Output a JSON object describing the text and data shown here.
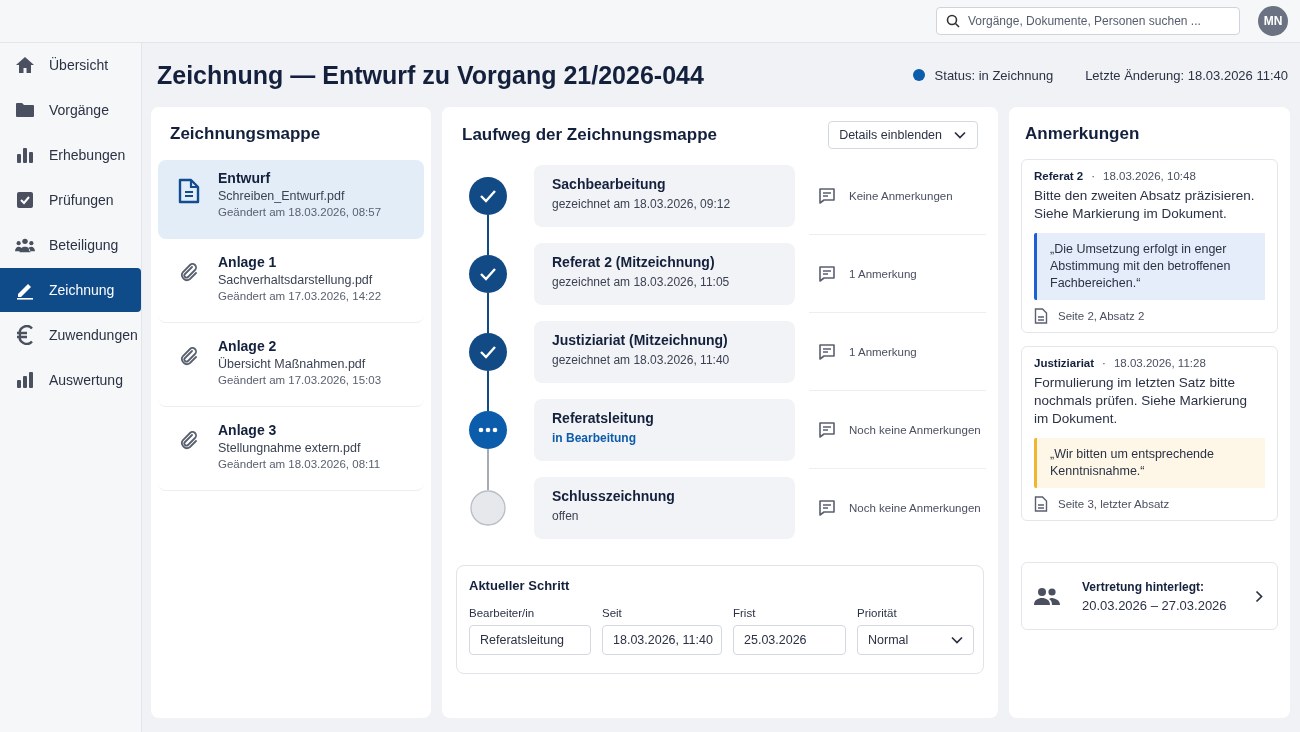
{
  "search": {
    "placeholder": "Vorgänge, Dokumente, Personen suchen ..."
  },
  "user": {
    "initials": "MN"
  },
  "sidebar": {
    "items": [
      {
        "label": "Übersicht",
        "selected": false
      },
      {
        "label": "Vorgänge",
        "selected": false
      },
      {
        "label": "Erhebungen",
        "selected": false
      },
      {
        "label": "Prüfungen",
        "selected": false
      },
      {
        "label": "Beteiligung",
        "selected": false
      },
      {
        "label": "Zeichnung",
        "selected": true
      },
      {
        "label": "Zuwendungen",
        "selected": false
      },
      {
        "label": "Auswertung",
        "selected": false
      }
    ]
  },
  "page": {
    "title": "Zeichnung — Entwurf zu Vorgang 21/2026-044",
    "status": "Status: in Zeichnung",
    "last_change": "Letzte Änderung: 18.03.2026 11:40"
  },
  "documents": {
    "title": "Zeichnungsmappe",
    "items": [
      {
        "kind": "document",
        "name": "Entwurf",
        "file": "Schreiben_Entwurf.pdf",
        "modified": "Geändert am 18.03.2026, 08:57",
        "selected": true
      },
      {
        "kind": "attachment",
        "name": "Anlage 1",
        "file": "Sachverhaltsdarstellung.pdf",
        "modified": "Geändert am 17.03.2026, 14:22",
        "selected": false
      },
      {
        "kind": "attachment",
        "name": "Anlage 2",
        "file": "Übersicht Maßnahmen.pdf",
        "modified": "Geändert am 17.03.2026, 15:03",
        "selected": false
      },
      {
        "kind": "attachment",
        "name": "Anlage 3",
        "file": "Stellungnahme extern.pdf",
        "modified": "Geändert am 18.03.2026, 08:11",
        "selected": false
      }
    ]
  },
  "route": {
    "title": "Laufweg der Zeichnungsmappe",
    "details_button": "Details einblenden",
    "steps": [
      {
        "name": "Sachbearbeitung",
        "detail": "gezeichnet am 18.03.2026, 09:12",
        "signed": true,
        "in_progress": false,
        "notes": "Keine Anmerkungen"
      },
      {
        "name": "Referat 2 (Mitzeichnung)",
        "detail": "gezeichnet am 18.03.2026, 11:05",
        "signed": true,
        "in_progress": false,
        "notes": "1 Anmerkung"
      },
      {
        "name": "Justiziariat (Mitzeichnung)",
        "detail": "gezeichnet am 18.03.2026, 11:40",
        "signed": true,
        "in_progress": false,
        "notes": "1 Anmerkung"
      },
      {
        "name": "Referatsleitung",
        "detail": "in Bearbeitung",
        "signed": false,
        "in_progress": true,
        "notes": "Noch keine Anmerkungen"
      },
      {
        "name": "Schlusszeichnung",
        "detail": "offen",
        "signed": false,
        "in_progress": false,
        "notes": "Noch keine Anmerkungen"
      }
    ],
    "current": {
      "title": "Aktueller Schritt",
      "fields": [
        {
          "kind": "text",
          "label": "Bearbeiter/in",
          "value": "Referatsleitung"
        },
        {
          "kind": "text",
          "label": "Seit",
          "value": "18.03.2026, 11:40"
        },
        {
          "kind": "text",
          "label": "Frist",
          "value": "25.03.2026"
        },
        {
          "kind": "select",
          "label": "Priorität",
          "value": "Normal"
        }
      ]
    }
  },
  "notes": {
    "title": "Anmerkungen",
    "items": [
      {
        "author": "Referat 2",
        "separator": "·",
        "time": "18.03.2026, 10:48",
        "text": "Bitte den zweiten Absatz präzisieren. Siehe Markierung im Dokument.",
        "quote": "„Die Umsetzung erfolgt in enger Abstimmung mit den betroffenen Fachbereichen.“",
        "color": "#1f5fd6",
        "location": "Seite 2, Absatz 2"
      },
      {
        "author": "Justiziariat",
        "separator": "·",
        "time": "18.03.2026, 11:28",
        "text": "Formulierung im letzten Satz bitte nochmals prüfen. Siehe Markierung im Dokument.",
        "quote": "„Wir bitten um entsprechende Kenntnisnahme.“",
        "color": "#f2b530",
        "location": "Seite 3, letzter Absatz"
      }
    ],
    "substitute": {
      "label": "Vertretung hinterlegt:",
      "dates": "20.03.2026 – 27.03.2026"
    }
  }
}
